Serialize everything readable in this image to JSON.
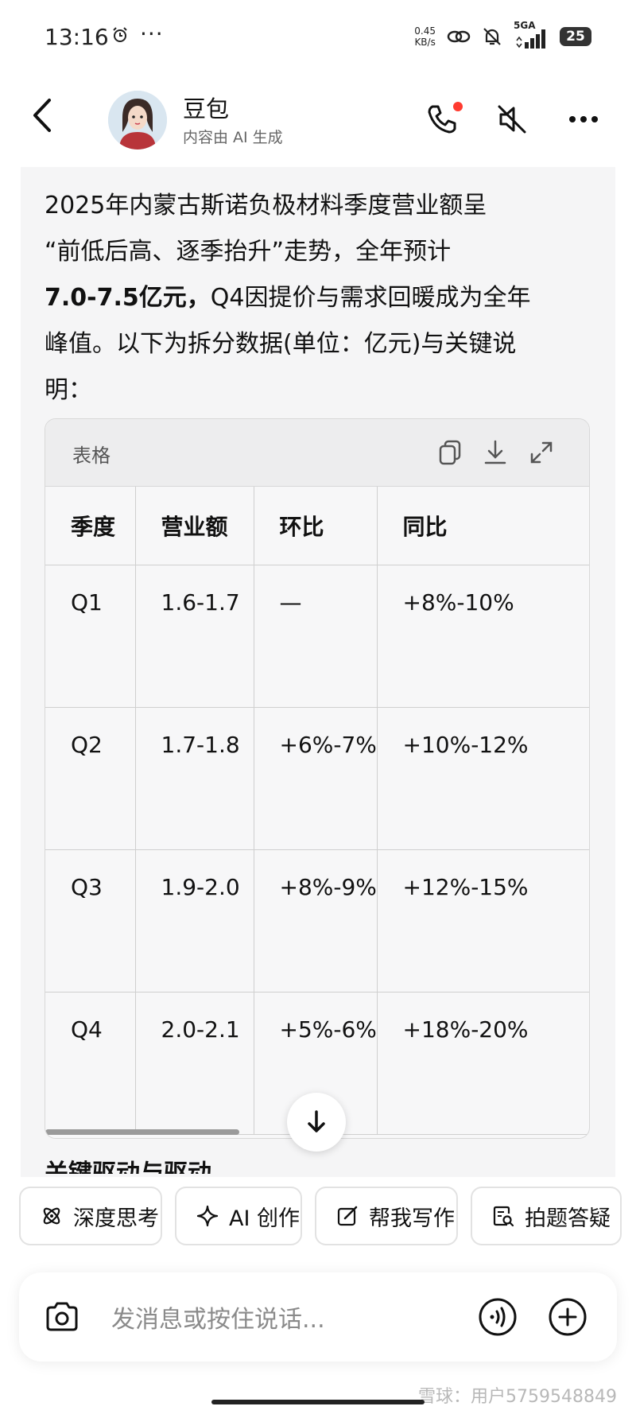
{
  "status_bar": {
    "time": "13:16",
    "dots": "···",
    "speed_value": "0.45",
    "speed_unit": "KB/s",
    "network": "5GA",
    "battery": "25"
  },
  "header": {
    "bot_name": "豆包",
    "subtitle": "内容由 AI 生成"
  },
  "message": {
    "line1": "2025年内蒙古斯诺负极材料季度营业额呈",
    "line2": "“前低后高、逐季抬升”走势，全年预计",
    "line3_bold": "7.0-7.5亿元，",
    "line3_rest": "Q4因提价与需求回暖成为全年",
    "line4": "峰值。以下为拆分数据(单位：亿元)与关键说",
    "line5": "明："
  },
  "table": {
    "title": "表格",
    "headers": [
      "季度",
      "营业额",
      "环比",
      "同比"
    ],
    "rows": [
      [
        "Q1",
        "1.6-1.7",
        "—",
        "+8%-10%"
      ],
      [
        "Q2",
        "1.7-1.8",
        "+6%-7%",
        "+10%-12%"
      ],
      [
        "Q3",
        "1.9-2.0",
        "+8%-9%",
        "+12%-15%"
      ],
      [
        "Q4",
        "2.0-2.1",
        "+5%-6%",
        "+18%-20%"
      ]
    ]
  },
  "next_heading_partial": "关键驱动与驱动",
  "chips": [
    {
      "label": "深度思考",
      "icon": "atom-icon"
    },
    {
      "label": "AI 创作",
      "icon": "sparkle-icon"
    },
    {
      "label": "帮我写作",
      "icon": "edit-icon"
    },
    {
      "label": "拍题答疑",
      "icon": "scan-question-icon"
    }
  ],
  "input": {
    "placeholder": "发消息或按住说话..."
  },
  "watermark": "雪球：用户5759548849",
  "colors": {
    "notification_dot": "#ff3b30",
    "card_bg": "#f5f5f6"
  }
}
